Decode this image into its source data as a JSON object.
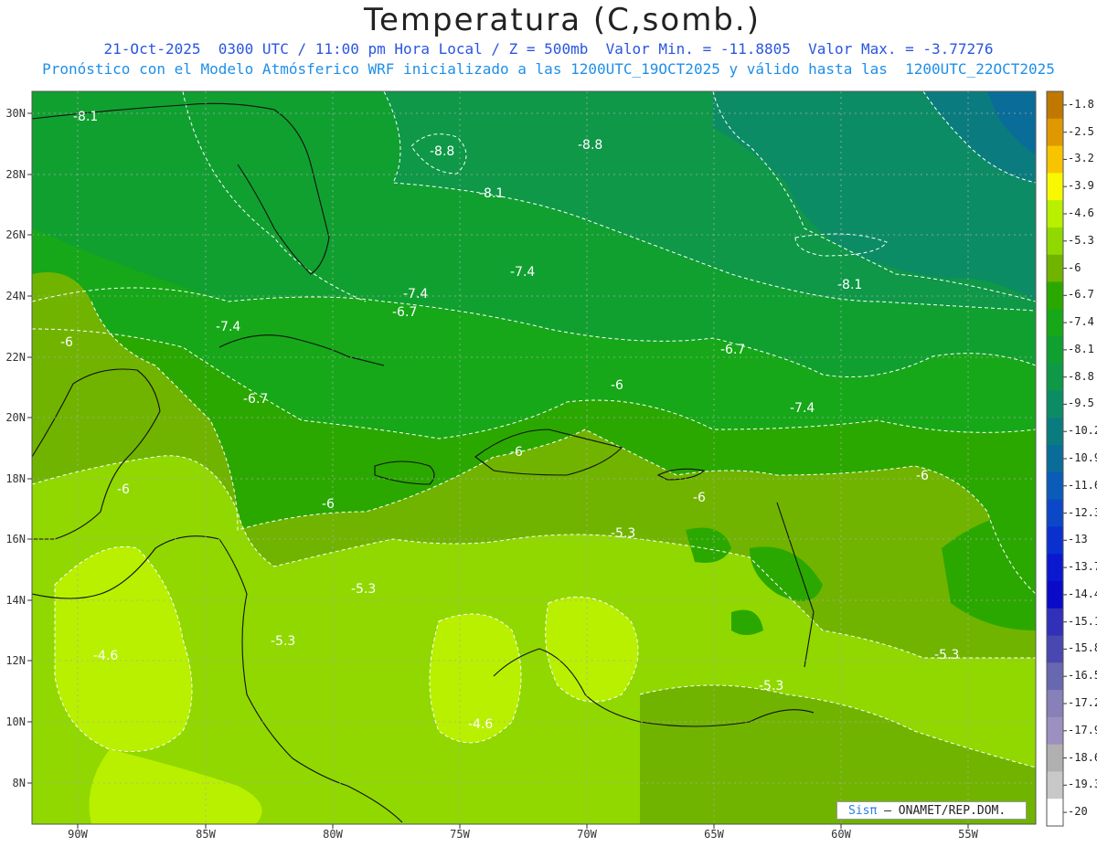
{
  "title": "Temperatura (C,somb.)",
  "subtitle_line1": "21-Oct-2025  0300 UTC / 11:00 pm Hora Local / Z = 500mb  Valor Min. = -11.8805  Valor Max. = -3.77276",
  "subtitle_line2": "Pronóstico con el Modelo Atmósferico WRF inicializado a las 1200UTC_19OCT2025 y válido hasta las  1200UTC_22OCT2025",
  "lat_ticks": [
    "30N",
    "28N",
    "26N",
    "24N",
    "22N",
    "20N",
    "18N",
    "16N",
    "14N",
    "12N",
    "10N",
    "8N"
  ],
  "lon_ticks": [
    "90W",
    "85W",
    "80W",
    "75W",
    "70W",
    "65W",
    "60W",
    "55W"
  ],
  "colorbar": {
    "labels": [
      "-1.8",
      "-2.5",
      "-3.2",
      "-3.9",
      "-4.6",
      "-5.3",
      "-6",
      "-6.7",
      "-7.4",
      "-8.1",
      "-8.8",
      "-9.5",
      "-10.2",
      "-10.9",
      "-11.6",
      "-12.3",
      "-13",
      "-13.7",
      "-14.4",
      "-15.1",
      "-15.8",
      "-16.5",
      "-17.2",
      "-17.9",
      "-18.6",
      "-19.3",
      "-20"
    ],
    "colors": [
      "#c07800",
      "#e09800",
      "#f8c400",
      "#f8f800",
      "#b8f000",
      "#90d800",
      "#70b400",
      "#2aa800",
      "#16a818",
      "#10a030",
      "#0e9848",
      "#0c8c64",
      "#0a7c80",
      "#0a6c98",
      "#0a5cb8",
      "#0a48c8",
      "#0a30d0",
      "#0a18d0",
      "#0a0ac8",
      "#3030b8",
      "#4848b0",
      "#6868b0",
      "#8880b8",
      "#9c90c0",
      "#b0b0b0",
      "#c8c8c8",
      "#ffffff"
    ]
  },
  "contour_labels": [
    {
      "text": "-8.1"
    },
    {
      "text": "-8.8"
    },
    {
      "text": "-8.8"
    },
    {
      "text": "-8.1"
    },
    {
      "text": "-7.4"
    },
    {
      "text": "-7.4"
    },
    {
      "text": "-6.7"
    },
    {
      "text": "-8.1"
    },
    {
      "text": "-7.4"
    },
    {
      "text": "-6"
    },
    {
      "text": "-6.7"
    },
    {
      "text": "-6.7"
    },
    {
      "text": "-6"
    },
    {
      "text": "-7.4"
    },
    {
      "text": "-6"
    },
    {
      "text": "-6"
    },
    {
      "text": "-6"
    },
    {
      "text": "-6"
    },
    {
      "text": "-6"
    },
    {
      "text": "-5.3"
    },
    {
      "text": "-5.3"
    },
    {
      "text": "-5.3"
    },
    {
      "text": "-4.6"
    },
    {
      "text": "-5.3"
    },
    {
      "text": "-5.3"
    },
    {
      "text": "-4.6"
    }
  ],
  "credit": {
    "sis": "Sisπ",
    "org": "– ONAMET/REP.DOM."
  }
}
